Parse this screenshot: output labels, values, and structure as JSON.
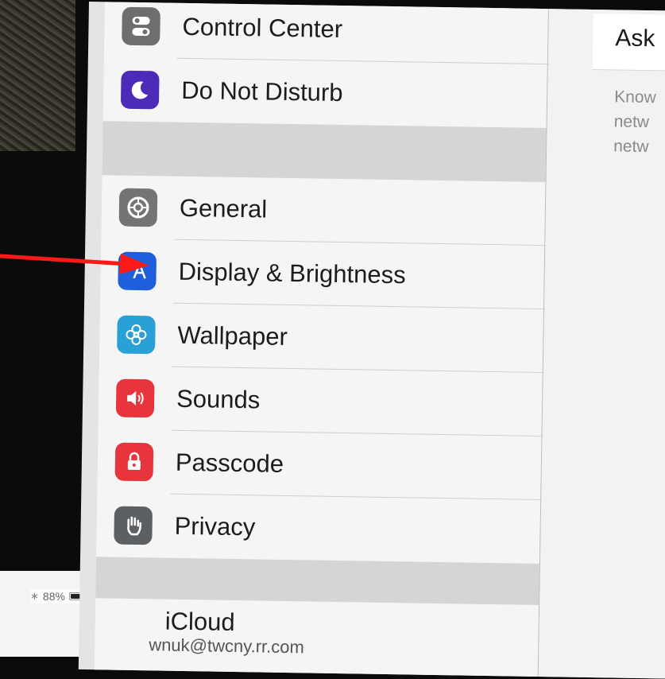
{
  "status_bar": {
    "bluetooth_icon": "bluetooth-icon",
    "battery_percent": "88%",
    "battery_level": 0.88
  },
  "settings_list": {
    "items": [
      {
        "label": "Control Center",
        "icon": "control-center-icon",
        "color": "#6d6e70"
      },
      {
        "label": "Do Not Disturb",
        "icon": "moon-icon",
        "color": "#4b2bb8"
      },
      {
        "label": "General",
        "icon": "gear-icon",
        "color": "#727476"
      },
      {
        "label": "Display & Brightness",
        "icon": "display-brightness-icon",
        "color": "#1f5fdc"
      },
      {
        "label": "Wallpaper",
        "icon": "flower-icon",
        "color": "#2aa1d6"
      },
      {
        "label": "Sounds",
        "icon": "speaker-icon",
        "color": "#e8343c"
      },
      {
        "label": "Passcode",
        "icon": "lock-icon",
        "color": "#e8343c"
      },
      {
        "label": "Privacy",
        "icon": "hand-icon",
        "color": "#5d6062"
      }
    ],
    "icloud": {
      "label": "iCloud",
      "account": "wnuk@twcny.rr.com"
    }
  },
  "detail_pane": {
    "field_title": "Ask",
    "note": "Know\nnetw\nnetw"
  },
  "annotation": {
    "arrow_color": "#ff1a1a"
  }
}
